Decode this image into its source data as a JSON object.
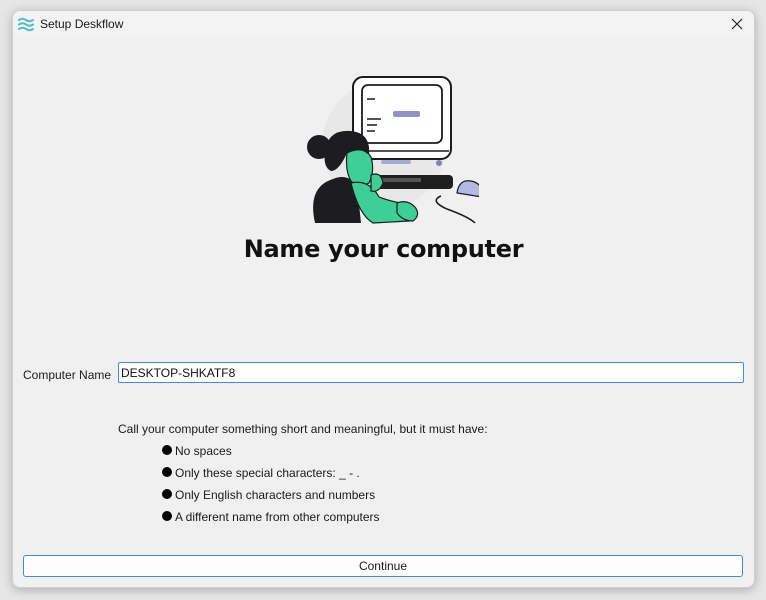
{
  "window": {
    "title": "Setup Deskflow",
    "app_icon": "deskflow-waves-icon",
    "close_icon": "close-icon"
  },
  "illustration": {
    "icon": "person-at-computer-illustration",
    "colors": {
      "accent_green": "#3ccf96",
      "dark": "#222222",
      "lavender": "#a6a8d8"
    }
  },
  "main": {
    "heading": "Name your computer",
    "computer_name": {
      "label": "Computer Name",
      "value": "DESKTOP-SHKATF8"
    },
    "help_intro": "Call your computer something short and meaningful, but it must have:",
    "rules": [
      "No spaces",
      "Only these special characters: _ - .",
      "Only English characters and numbers",
      "A different name from other computers"
    ]
  },
  "footer": {
    "continue_label": "Continue"
  },
  "colors": {
    "window_bg": "#f0f0f0",
    "focus_border": "#3a8ee6"
  }
}
